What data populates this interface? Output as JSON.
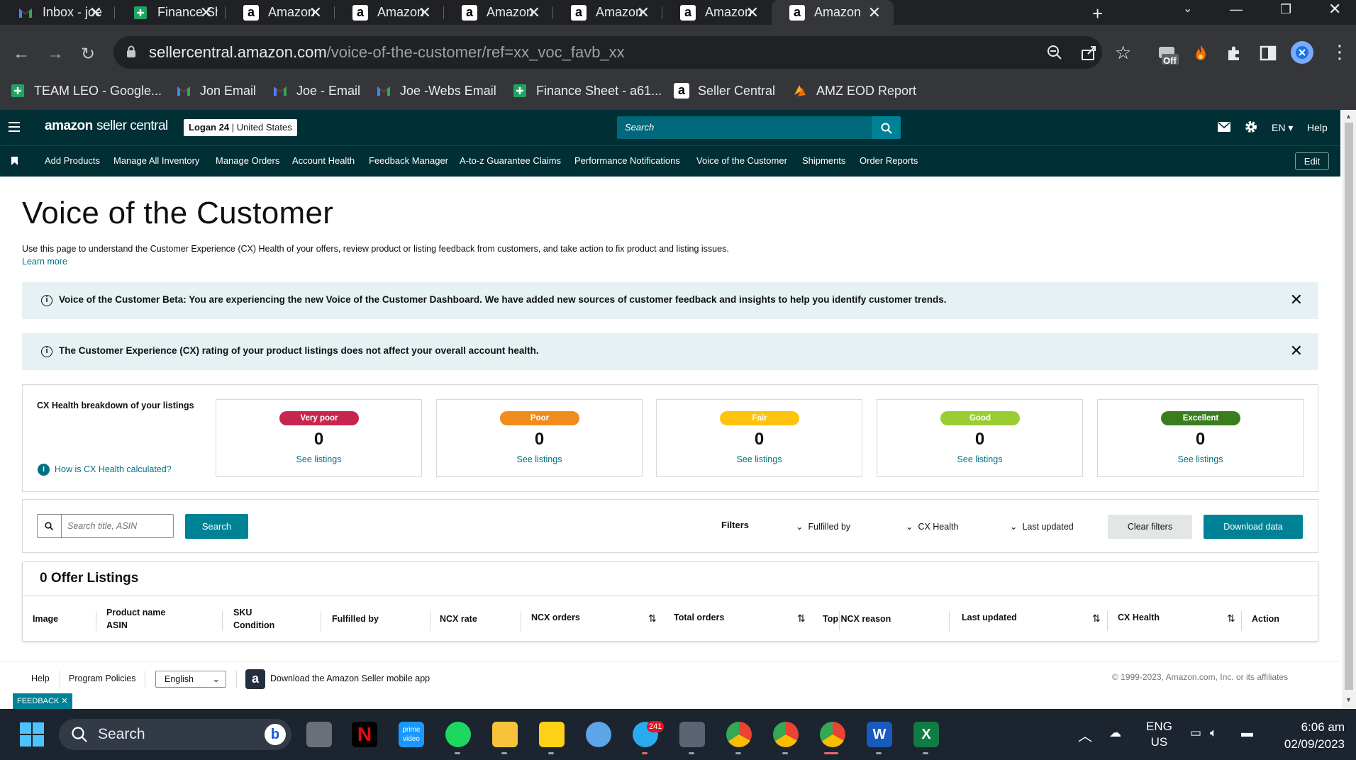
{
  "browser": {
    "tabs": [
      {
        "label": "Inbox - joe",
        "icon": "gmail-icon"
      },
      {
        "label": "Finance She",
        "icon": "google-sheets-icon"
      },
      {
        "label": "Amazon",
        "icon": "amazon-icon"
      },
      {
        "label": "Amazon",
        "icon": "amazon-icon"
      },
      {
        "label": "Amazon",
        "icon": "amazon-icon"
      },
      {
        "label": "Amazon",
        "icon": "amazon-icon"
      },
      {
        "label": "Amazon",
        "icon": "amazon-icon"
      },
      {
        "label": "Amazon",
        "icon": "amazon-icon"
      }
    ],
    "url_host": "sellercentral.amazon.com",
    "url_path": "/voice-of-the-customer/ref=xx_voc_favb_xx",
    "ext_badge": "Off",
    "bookmarks": [
      {
        "label": "TEAM LEO - Google...",
        "icon": "google-sheets-icon"
      },
      {
        "label": "Jon Email",
        "icon": "gmail-icon"
      },
      {
        "label": "Joe - Email",
        "icon": "gmail-icon"
      },
      {
        "label": "Joe -Webs Email",
        "icon": "gmail-icon"
      },
      {
        "label": "Finance Sheet - a61...",
        "icon": "google-sheets-icon"
      },
      {
        "label": "Seller Central",
        "icon": "amazon-icon"
      },
      {
        "label": "AMZ EOD Report",
        "icon": "amz-report-icon"
      }
    ]
  },
  "header": {
    "logo_bold": "amazon",
    "logo_rest": "seller central",
    "account_name": "Logan 24",
    "account_region": "United States",
    "search_placeholder": "Search",
    "language": "EN",
    "help": "Help"
  },
  "nav": {
    "items": [
      "Add Products",
      "Manage All Inventory",
      "Manage Orders",
      "Account Health",
      "Feedback Manager",
      "A-to-z Guarantee Claims",
      "Performance Notifications",
      "Voice of the Customer",
      "Shipments",
      "Order Reports"
    ],
    "edit": "Edit"
  },
  "page": {
    "title": "Voice of the Customer",
    "description": "Use this page to understand the Customer Experience (CX) Health of your offers, review product or listing feedback from customers, and take action to fix product and listing issues.",
    "learn_more": "Learn more",
    "alerts": [
      "Voice of the Customer Beta: You are experiencing the new Voice of the Customer Dashboard. We have added new sources of customer feedback and insights to help you identify customer trends.",
      "The Customer Experience (CX) rating of your product listings does not affect your overall account health."
    ],
    "breakdown_title": "CX Health breakdown of your listings",
    "how_calculated": "How is CX Health calculated?",
    "cards": [
      {
        "label": "Very poor",
        "count": "0",
        "link": "See listings",
        "color": "#c7254e"
      },
      {
        "label": "Poor",
        "count": "0",
        "link": "See listings",
        "color": "#f08c1c"
      },
      {
        "label": "Fair",
        "count": "0",
        "link": "See listings",
        "color": "#ffc30f"
      },
      {
        "label": "Good",
        "count": "0",
        "link": "See listings",
        "color": "#9acd32"
      },
      {
        "label": "Excellent",
        "count": "0",
        "link": "See listings",
        "color": "#3a7d1f"
      }
    ],
    "search_placeholder": "Search title, ASIN",
    "search_button": "Search",
    "filters_label": "Filters",
    "filters": [
      "Fulfilled by",
      "CX Health",
      "Last updated"
    ],
    "clear_filters": "Clear filters",
    "download": "Download data",
    "listings_title": "0 Offer Listings",
    "columns": [
      {
        "line1": "Image",
        "line2": ""
      },
      {
        "line1": "Product name",
        "line2": "ASIN"
      },
      {
        "line1": "SKU",
        "line2": "Condition"
      },
      {
        "line1": "Fulfilled by",
        "line2": ""
      },
      {
        "line1": "NCX rate",
        "line2": ""
      },
      {
        "line1": "NCX orders",
        "line2": ""
      },
      {
        "line1": "Total orders",
        "line2": ""
      },
      {
        "line1": "Top NCX reason",
        "line2": ""
      },
      {
        "line1": "Last updated",
        "line2": ""
      },
      {
        "line1": "CX Health",
        "line2": ""
      },
      {
        "line1": "Action",
        "line2": ""
      }
    ]
  },
  "footer": {
    "help": "Help",
    "policies": "Program Policies",
    "language": "English",
    "app": "Download the Amazon Seller mobile app",
    "copyright": "© 1999-2023, Amazon.com, Inc. or its affiliates",
    "feedback": "FEEDBACK"
  },
  "taskbar": {
    "search": "Search",
    "telegram_badge": "241",
    "lang_line1": "ENG",
    "lang_line2": "US",
    "time": "6:06 am",
    "date": "02/09/2023"
  }
}
